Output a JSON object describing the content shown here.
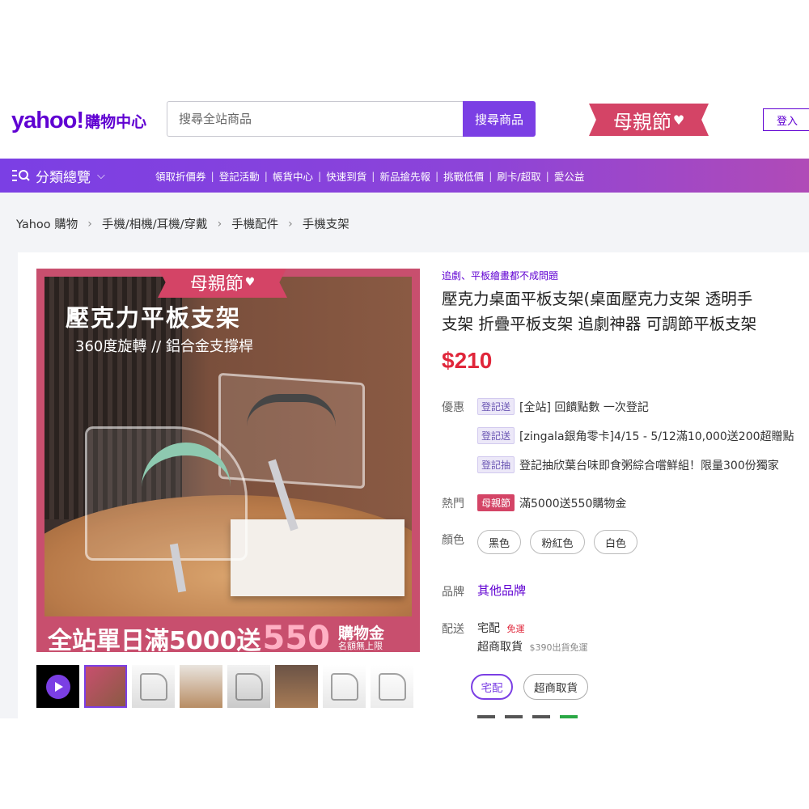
{
  "header": {
    "logo_brand": "yahoo!",
    "logo_section": "購物中心",
    "search_placeholder": "搜尋全站商品",
    "search_button": "搜尋商品",
    "mothers_day_badge": "母親節",
    "login_label": "登入"
  },
  "nav": {
    "category_label": "分類總覽",
    "links": [
      "領取折價券",
      "登記活動",
      "帳貨中心",
      "快速到貨",
      "新品搶先報",
      "挑戰低價",
      "刷卡/超取",
      "愛公益"
    ]
  },
  "breadcrumb": [
    "Yahoo 購物",
    "手機/相機/耳機/穿戴",
    "手機配件",
    "手機支架"
  ],
  "image": {
    "badge": "母親節",
    "title": "壓克力平板支架",
    "subtitle": "360度旋轉 // 鋁合金支撐桿",
    "banner_pre": "全站單日滿5000送",
    "banner_big": "550",
    "banner_post_a": "購物金",
    "banner_post_b": "名額無上限"
  },
  "thumbnails": [
    "video",
    "image-1",
    "image-2",
    "image-3",
    "image-4",
    "image-5",
    "image-6",
    "image-7"
  ],
  "product": {
    "promo_line": "追劇、平板繪畫都不成問題",
    "title_line1": "壓克力桌面平板支架(桌面壓克力支架 透明手",
    "title_line2": "支架 折疊平板支架 追劇神器 可調節平板支架",
    "price": "$210"
  },
  "offers": {
    "label": "優惠",
    "items": [
      {
        "tag": "登記送",
        "text": "[全站] 回饋點數 一次登記"
      },
      {
        "tag": "登記送",
        "text": "[zingala銀角零卡]4/15 - 5/12滿10,000送200超贈點"
      },
      {
        "tag": "登記抽",
        "text": "登記抽欣葉台味即食粥綜合嚐鮮組！限量300份獨家"
      }
    ]
  },
  "hot": {
    "label": "熱門",
    "tag": "母親節",
    "text": "滿5000送550購物金"
  },
  "colors": {
    "label": "顏色",
    "options": [
      "黑色",
      "粉紅色",
      "白色"
    ]
  },
  "brand": {
    "label": "品牌",
    "value": "其他品牌"
  },
  "shipping": {
    "label": "配送",
    "home": "宅配",
    "home_free": "免運",
    "store": "超商取貨",
    "store_note": "$390出貨免運",
    "buttons": [
      "宅配",
      "超商取貨"
    ]
  },
  "theme": {
    "accent": "#7b3fe4",
    "brand_purple": "#6001d2",
    "price_red": "#e0263a",
    "festival_pink": "#d44466"
  }
}
